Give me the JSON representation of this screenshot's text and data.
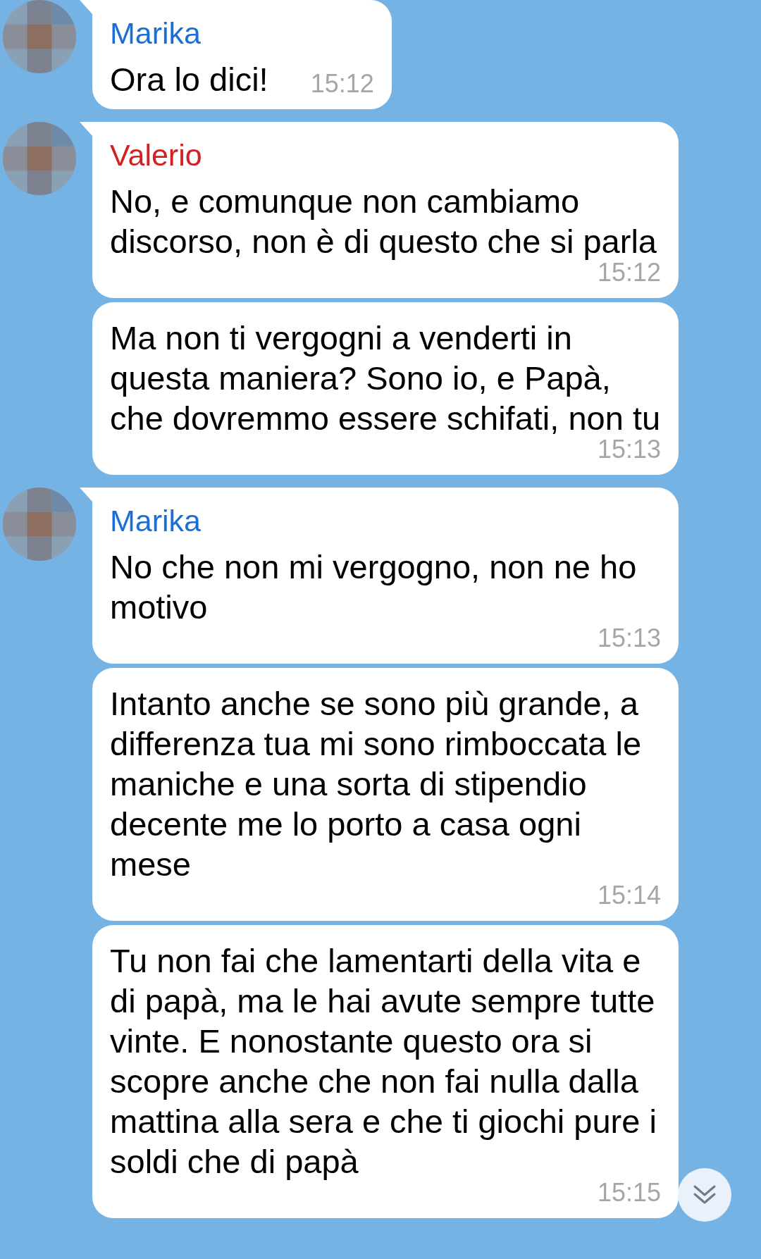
{
  "messages": [
    {
      "sender": "Marika",
      "color": "#1a6fd6",
      "avatar": true,
      "text": "Ora lo dici!",
      "time": "15:12"
    },
    {
      "sender": "Valerio",
      "color": "#d42020",
      "avatar": true,
      "text": "No, e comunque non cambiamo discorso, non è di questo che si parla",
      "time": "15:12"
    },
    {
      "avatar": false,
      "text": "Ma non ti vergogni a venderti in questa maniera? Sono io, e Papà, che dovremmo essere schifati, non tu",
      "time": "15:13"
    },
    {
      "sender": "Marika",
      "color": "#1a6fd6",
      "avatar": true,
      "text": "No che non mi vergogno, non ne ho motivo",
      "time": "15:13"
    },
    {
      "avatar": false,
      "text": "Intanto anche se sono più grande, a differenza tua mi sono rimboccata le maniche e una sorta di stipendio decente me lo porto a casa ogni mese",
      "time": "15:14"
    },
    {
      "avatar": false,
      "text": "Tu non fai che lamentarti della vita e di papà, ma le hai avute sempre tutte vinte. E nonostante questo ora si scopre anche che non fai nulla dalla mattina alla sera e che ti giochi pure i soldi che di papà",
      "time": "15:15"
    }
  ]
}
